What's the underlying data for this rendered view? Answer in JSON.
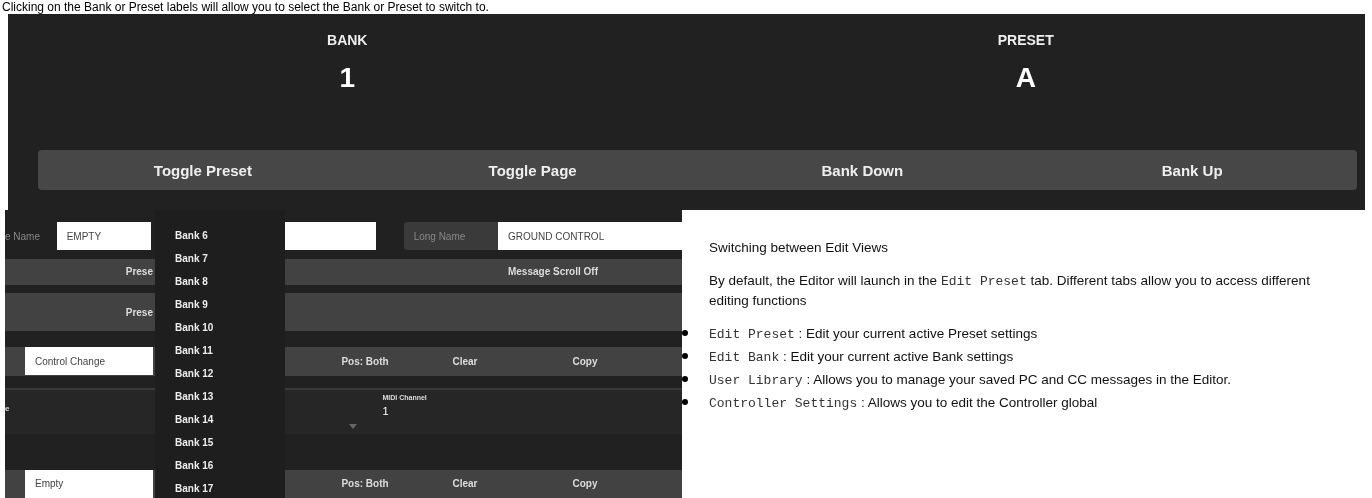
{
  "intro_text": "Clicking on the Bank or Preset labels will allow you to select the Bank or Preset to switch to.",
  "status_panel": {
    "bank_label": "BANK",
    "bank_value": "1",
    "preset_label": "PRESET",
    "preset_value": "A",
    "buttons": [
      "Toggle Preset",
      "Toggle Page",
      "Bank Down",
      "Bank Up"
    ]
  },
  "editor": {
    "rows": [
      {
        "kind": "names",
        "name_label": "e Name",
        "name_value": "EMPTY",
        "long_label": "Long Name",
        "long_value": "GROUND CONTROL"
      },
      {
        "kind": "bar",
        "left": "Prese",
        "right": "Message Scroll Off"
      },
      {
        "kind": "tallbar",
        "left": "Prese"
      },
      {
        "kind": "message",
        "type_value": "Control Change",
        "actions": [
          "Pos: Both",
          "Clear",
          "Copy"
        ]
      },
      {
        "kind": "channel",
        "label": "e",
        "channel_label": "MIDI Channel",
        "channel_value": "1"
      },
      {
        "kind": "message",
        "type_value": "Empty",
        "actions": [
          "Pos: Both",
          "Clear",
          "Copy"
        ]
      }
    ]
  },
  "bank_dropdown": {
    "items": [
      "Bank 6",
      "Bank 7",
      "Bank 8",
      "Bank 9",
      "Bank 10",
      "Bank 11",
      "Bank 12",
      "Bank 13",
      "Bank 14",
      "Bank 15",
      "Bank 16",
      "Bank 17"
    ]
  },
  "article": {
    "heading": "Switching between Edit Views",
    "paragraph": {
      "before": "By default, the Editor will launch in the ",
      "code": "Edit Preset",
      "after": " tab. Different tabs allow you to access different editing functions"
    },
    "items": [
      {
        "code": "Edit Preset",
        "text": " : Edit your current active Preset settings"
      },
      {
        "code": "Edit Bank",
        "text": " : Edit your current active Bank settings"
      },
      {
        "code": "User Library",
        "text": " : Allows you to manage your saved PC and CC messages in the Editor."
      },
      {
        "code": "Controller Settings",
        "text": " : Allows you to edit the Controller global"
      }
    ]
  }
}
